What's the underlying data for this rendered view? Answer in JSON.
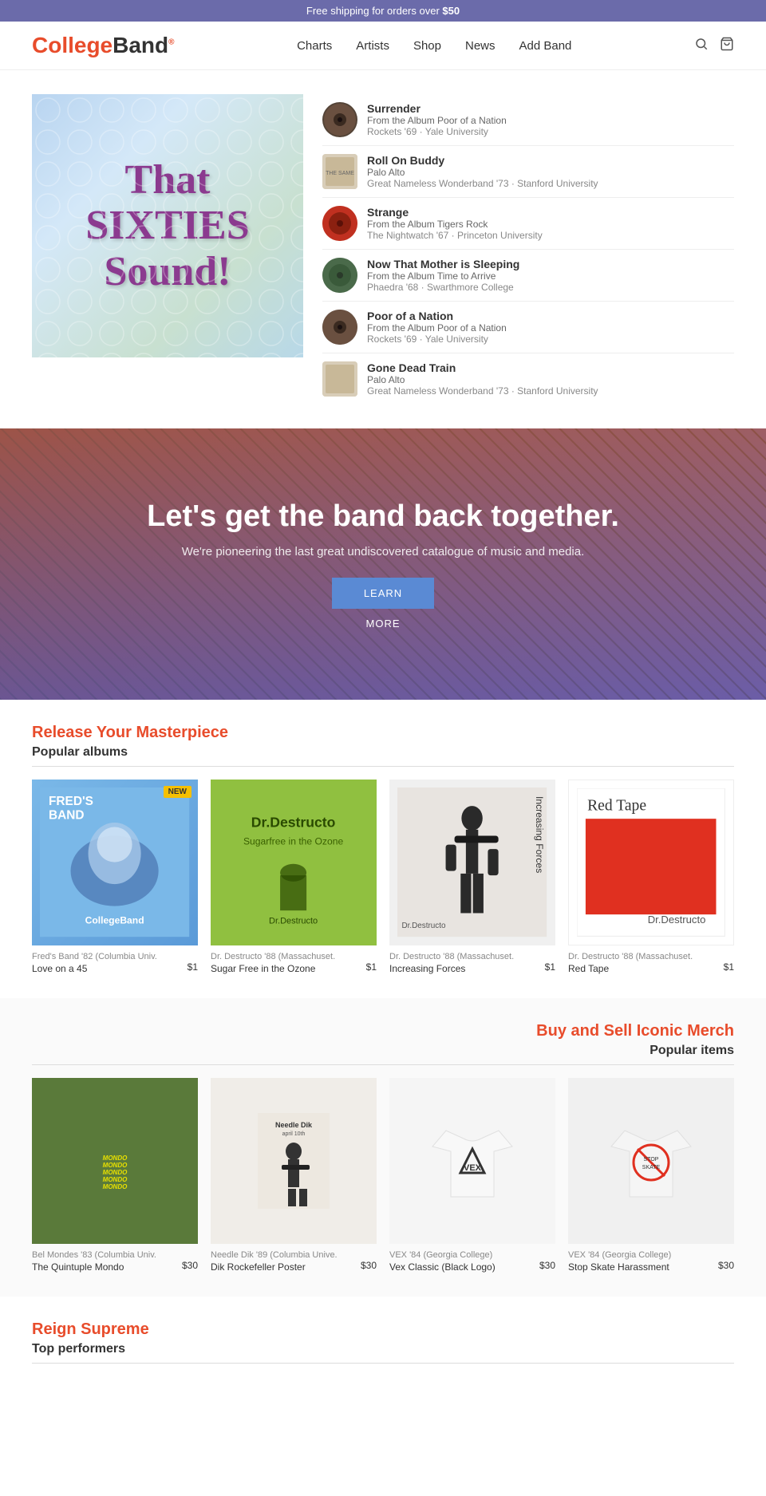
{
  "banner": {
    "text": "Free shipping for orders over ",
    "amount": "$50"
  },
  "header": {
    "logo_college": "College",
    "logo_band": "Band",
    "nav": [
      {
        "label": "Charts",
        "href": "#"
      },
      {
        "label": "Artists",
        "href": "#"
      },
      {
        "label": "Shop",
        "href": "#"
      },
      {
        "label": "News",
        "href": "#"
      },
      {
        "label": "Add Band",
        "href": "#"
      }
    ]
  },
  "hero": {
    "image_text_line1": "That",
    "image_text_line2": "SIXTIES",
    "image_text_line3": "Sound!"
  },
  "tracklist": [
    {
      "title": "Surrender",
      "album": "From the Album Poor of a Nation",
      "artist": "Rockets '69 · Yale University"
    },
    {
      "title": "Roll On Buddy",
      "album": "Palo Alto",
      "artist": "Great Nameless Wonderband '73 · Stanford University"
    },
    {
      "title": "Strange",
      "album": "From the Album Tigers Rock",
      "artist": "The Nightwatch '67 · Princeton University"
    },
    {
      "title": "Now That Mother is Sleeping",
      "album": "From the Album Time to Arrive",
      "artist": "Phaedra '68 · Swarthmore College"
    },
    {
      "title": "Poor of a Nation",
      "album": "From the Album Poor of a Nation",
      "artist": "Rockets '69 · Yale University"
    },
    {
      "title": "Gone Dead Train",
      "album": "Palo Alto",
      "artist": "Great Nameless Wonderband '73 · Stanford University"
    }
  ],
  "hero_banner": {
    "headline": "Let's get the band back together.",
    "subtext": "We're pioneering the last great undiscovered catalogue of music and media.",
    "btn_learn": "LEARN",
    "btn_more": "MORE"
  },
  "release_section": {
    "title": "Release Your Masterpiece",
    "subtitle": "Popular albums",
    "albums": [
      {
        "badge": "NEW",
        "meta": "Fred's Band '82 (Columbia Univ.",
        "name": "Love on a 45",
        "price": "$1"
      },
      {
        "meta": "Dr. Destructo '88 (Massachuset.",
        "name": "Sugar Free in the Ozone",
        "price": "$1"
      },
      {
        "meta": "Dr. Destructo '88 (Massachuset.",
        "name": "Increasing Forces",
        "price": "$1"
      },
      {
        "meta": "Dr. Destructo '88 (Massachuset.",
        "name": "Red Tape",
        "price": "$1"
      }
    ]
  },
  "merch_section": {
    "title": "Buy and Sell Iconic Merch",
    "subtitle": "Popular items",
    "items": [
      {
        "meta": "Bel Mondes '83 (Columbia Univ.",
        "name": "The Quintuple Mondo",
        "price": "$30"
      },
      {
        "meta": "Needle Dik '89 (Columbia Unive.",
        "name": "Dik Rockefeller Poster",
        "price": "$30"
      },
      {
        "meta": "VEX '84 (Georgia College)",
        "name": "Vex Classic (Black Logo)",
        "price": "$30"
      },
      {
        "meta": "VEX '84 (Georgia College)",
        "name": "Stop Skate Harassment",
        "price": "$30"
      }
    ]
  },
  "reign_section": {
    "title": "Reign Supreme",
    "subtitle": "Top performers"
  }
}
